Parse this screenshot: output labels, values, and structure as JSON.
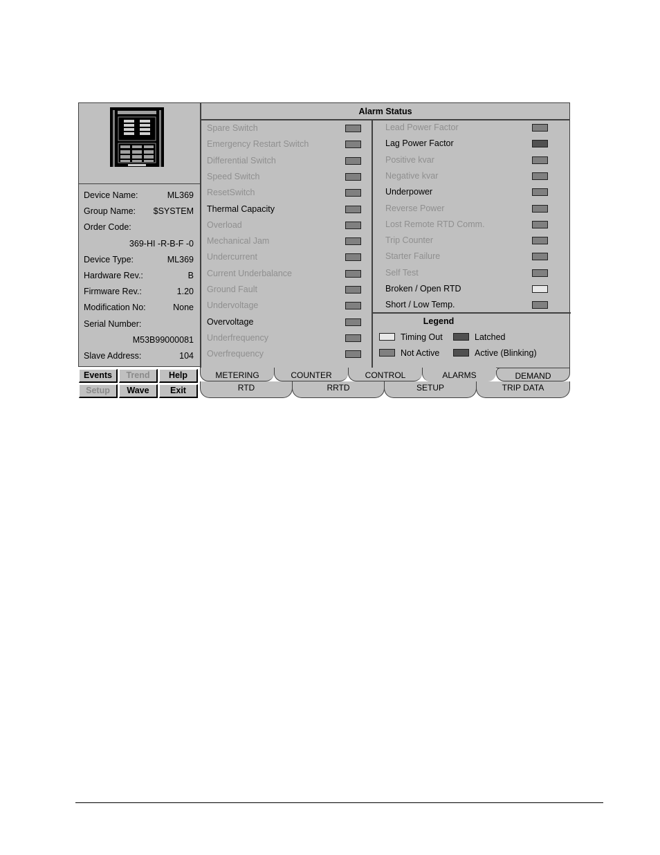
{
  "device_info": {
    "rows": [
      {
        "label": "Device Name:",
        "value": "ML369"
      },
      {
        "label": "Group Name:",
        "value": "$SYSTEM"
      },
      {
        "label": "Order Code:",
        "value": ""
      },
      {
        "label": "",
        "value": "369-HI -R-B-F -0"
      },
      {
        "label": "Device Type:",
        "value": "ML369"
      },
      {
        "label": "Hardware Rev.:",
        "value": "B"
      },
      {
        "label": "Firmware Rev.:",
        "value": "1.20"
      },
      {
        "label": "Modification No:",
        "value": "None"
      },
      {
        "label": "Serial Number:",
        "value": ""
      },
      {
        "label": "",
        "value": "M53B99000081"
      },
      {
        "label": "Slave Address:",
        "value": "104"
      }
    ]
  },
  "buttons": [
    {
      "label": "Events",
      "enabled": true
    },
    {
      "label": "Trend",
      "enabled": false
    },
    {
      "label": "Help",
      "enabled": true
    },
    {
      "label": "Setup",
      "enabled": false
    },
    {
      "label": "Wave",
      "enabled": true
    },
    {
      "label": "Exit",
      "enabled": true
    }
  ],
  "alarm_status": {
    "title": "Alarm Status",
    "left_column": [
      {
        "label": "Spare Switch",
        "state": "not_active",
        "highlighted": false
      },
      {
        "label": "Emergency Restart Switch",
        "state": "not_active",
        "highlighted": false
      },
      {
        "label": "Differential Switch",
        "state": "not_active",
        "highlighted": false
      },
      {
        "label": "Speed Switch",
        "state": "not_active",
        "highlighted": false
      },
      {
        "label": "ResetSwitch",
        "state": "not_active",
        "highlighted": false
      },
      {
        "label": "Thermal Capacity",
        "state": "not_active",
        "highlighted": true
      },
      {
        "label": "Overload",
        "state": "not_active",
        "highlighted": false
      },
      {
        "label": "Mechanical Jam",
        "state": "not_active",
        "highlighted": false
      },
      {
        "label": "Undercurrent",
        "state": "not_active",
        "highlighted": false
      },
      {
        "label": "Current Underbalance",
        "state": "not_active",
        "highlighted": false
      },
      {
        "label": "Ground Fault",
        "state": "not_active",
        "highlighted": false
      },
      {
        "label": "Undervoltage",
        "state": "not_active",
        "highlighted": false
      },
      {
        "label": "Overvoltage",
        "state": "not_active",
        "highlighted": true
      },
      {
        "label": "Underfrequency",
        "state": "not_active",
        "highlighted": false
      },
      {
        "label": "Overfrequency",
        "state": "not_active",
        "highlighted": false
      }
    ],
    "right_column": [
      {
        "label": "Lead Power Factor",
        "state": "not_active",
        "highlighted": false
      },
      {
        "label": "Lag Power Factor",
        "state": "latched",
        "highlighted": true
      },
      {
        "label": "Positive kvar",
        "state": "not_active",
        "highlighted": false
      },
      {
        "label": "Negative kvar",
        "state": "not_active",
        "highlighted": false
      },
      {
        "label": "Underpower",
        "state": "not_active",
        "highlighted": true
      },
      {
        "label": "Reverse Power",
        "state": "not_active",
        "highlighted": false
      },
      {
        "label": "Lost Remote RTD Comm.",
        "state": "not_active",
        "highlighted": false
      },
      {
        "label": "Trip Counter",
        "state": "not_active",
        "highlighted": false
      },
      {
        "label": "Starter Failure",
        "state": "not_active",
        "highlighted": false
      },
      {
        "label": "Self Test",
        "state": "not_active",
        "highlighted": false
      },
      {
        "label": "Broken / Open RTD",
        "state": "timing_out",
        "highlighted": true
      },
      {
        "label": "Short / Low Temp.",
        "state": "not_active",
        "highlighted": true
      }
    ]
  },
  "legend": {
    "title": "Legend",
    "items": [
      {
        "label": "Timing Out",
        "state": "timing_out"
      },
      {
        "label": "Latched",
        "state": "latched"
      },
      {
        "label": "Not Active",
        "state": "not_active"
      },
      {
        "label": "Active (Blinking)",
        "state": "active_blinking"
      }
    ]
  },
  "state_colors": {
    "timing_out": "#e8e8e8",
    "latched": "#505050",
    "not_active": "#808080",
    "active_blinking": "#505050"
  },
  "tabs": {
    "row1": [
      {
        "label": "METERING",
        "active": false
      },
      {
        "label": "COUNTER",
        "active": false
      },
      {
        "label": "CONTROL",
        "active": false
      },
      {
        "label": "ALARMS",
        "active": true
      },
      {
        "label": "DEMAND",
        "active": false
      }
    ],
    "row2": [
      {
        "label": "RTD"
      },
      {
        "label": "RRTD"
      },
      {
        "label": "SETUP"
      },
      {
        "label": "TRIP DATA"
      }
    ]
  }
}
